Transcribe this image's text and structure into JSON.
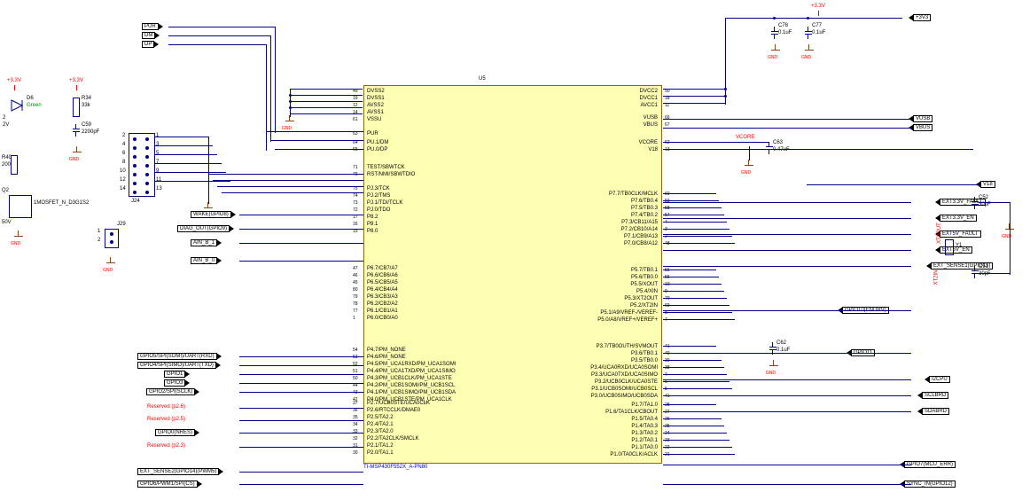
{
  "chip": {
    "ref": "U5",
    "part": "TI-MSP430F552X_A-PN80",
    "pins_left": [
      {
        "num": "49",
        "name": "DVSS2"
      },
      {
        "num": "19",
        "name": "DVSS1"
      },
      {
        "num": "12",
        "name": "AVSS2"
      },
      {
        "num": "14",
        "name": "AVSS1"
      },
      {
        "num": "61",
        "name": "VSSU"
      },
      {
        "num": "63",
        "name": "PUR"
      },
      {
        "num": "64",
        "name": "PU.1/DM"
      },
      {
        "num": "65",
        "name": "PU.0/DP"
      },
      {
        "num": "71",
        "name": "TEST/SBWTCK"
      },
      {
        "num": "76",
        "name": "RST/NMI/SBWTDIO"
      },
      {
        "num": "75",
        "name": "PJ.3/TCK"
      },
      {
        "num": "74",
        "name": "PJ.2/TMS"
      },
      {
        "num": "73",
        "name": "PJ.1/TDI/TCLK"
      },
      {
        "num": "72",
        "name": "PJ.0/TDO"
      },
      {
        "num": "17",
        "name": "P8.2"
      },
      {
        "num": "16",
        "name": "P8.1"
      },
      {
        "num": "15",
        "name": "P8.0"
      },
      {
        "num": "47",
        "name": "P6.7/CB7/A7"
      },
      {
        "num": "46",
        "name": "P6.6/CB6/A6"
      },
      {
        "num": "45",
        "name": "P6.5/CB5/A5"
      },
      {
        "num": "80",
        "name": "P6.4/CB4/A4"
      },
      {
        "num": "79",
        "name": "P6.3/CB3/A3"
      },
      {
        "num": "78",
        "name": "P6.2/CB2/A2"
      },
      {
        "num": "77",
        "name": "P6.1/CB1/A1"
      },
      {
        "num": "1",
        "name": "P6.0/CB0/A0"
      },
      {
        "num": "54",
        "name": "P4.7/PM_NONE"
      },
      {
        "num": "53",
        "name": "P4.6/PM_NONE"
      },
      {
        "num": "52",
        "name": "P4.5/PM_UCA1RXD/PM_UCA1SOMI"
      },
      {
        "num": "51",
        "name": "P4.4/PM_UCA1TXD/PM_UCA1SIMO"
      },
      {
        "num": "50",
        "name": "P4.3/PM_UCB1CLK/PM_UCA1STE"
      },
      {
        "num": "44",
        "name": "P4.2/PM_UCB1SOMI/PM_UCB1SCL"
      },
      {
        "num": "43",
        "name": "P4.1/PM_UCB1SIMO/PM_UCB1SDA"
      },
      {
        "num": "42",
        "name": "P4.0/PM_UCB1STE/PM_UCA1CLK"
      },
      {
        "num": "37",
        "name": "P2.7/UCB0STE/UCA0CLK"
      },
      {
        "num": "36",
        "name": "P2.6/RTCCLK/DMAE0"
      },
      {
        "num": "35",
        "name": "P2.5/TA2.2"
      },
      {
        "num": "34",
        "name": "P2.4/TA2.1"
      },
      {
        "num": "33",
        "name": "P2.3/TA2.0"
      },
      {
        "num": "32",
        "name": "P2.2/TA2CLK/SMCLK"
      },
      {
        "num": "31",
        "name": "P2.1/TA1.2"
      },
      {
        "num": "30",
        "name": "P2.0/TA1.1"
      }
    ],
    "pins_right": [
      {
        "num": "50",
        "name": "DVCC2"
      },
      {
        "num": "18",
        "name": "DVCC1"
      },
      {
        "num": "11",
        "name": "AVCC1"
      },
      {
        "num": "66",
        "name": "VUSB"
      },
      {
        "num": "67",
        "name": "VBUS"
      },
      {
        "num": "62",
        "name": "VCORE"
      },
      {
        "num": "13",
        "name": "V18"
      },
      {
        "num": "60",
        "name": "P7.7/TB0CLK/MCLK"
      },
      {
        "num": "59",
        "name": "P7.6/TB0.4"
      },
      {
        "num": "58",
        "name": "P7.5/TB0.3"
      },
      {
        "num": "57",
        "name": "P7.4/TB0.2"
      },
      {
        "num": "4",
        "name": "P7.3/CB11/A15"
      },
      {
        "num": "3",
        "name": "P7.2/CB10/A14"
      },
      {
        "num": "2",
        "name": "P7.1/CB9/A13"
      },
      {
        "num": "48",
        "name": "P7.0/CB8/A12"
      },
      {
        "num": "56",
        "name": "P5.7/TB0.1"
      },
      {
        "num": "55",
        "name": "P5.6/TB0.0"
      },
      {
        "num": "10",
        "name": "P5.5/XOUT"
      },
      {
        "num": "9",
        "name": "P5.4/XIN"
      },
      {
        "num": "70",
        "name": "P5.3/XT2OUT"
      },
      {
        "num": "69",
        "name": "P5.2/XT2IN"
      },
      {
        "num": "8",
        "name": "P5.1/A9/VREF-/VEREF-"
      },
      {
        "num": "7",
        "name": "P5.0/A8/VREF+/VEREF+"
      },
      {
        "num": "41",
        "name": "P3.7/TB0OUTH/SVMOUT"
      },
      {
        "num": "40",
        "name": "P3.6/TB0.1"
      },
      {
        "num": "39",
        "name": "P3.5/TB0.0"
      },
      {
        "num": "38",
        "name": "P3.4/UCA0RXD/UCA0SOMI"
      },
      {
        "num": "7",
        "name": "P3.3/UCA0TXD/UCA0SIMO"
      },
      {
        "num": "6",
        "name": "P3.2/UCB0CLK/UCA0STE"
      },
      {
        "num": "5",
        "name": "P3.1/UCB0SOMI/UCB0SCL"
      },
      {
        "num": "41",
        "name": "P3.0/UCB0SIMO/UCB0SDA"
      },
      {
        "num": "28",
        "name": "P1.7/TA1.0"
      },
      {
        "num": "27",
        "name": "P1.6/TA1CLK/CBOUT"
      },
      {
        "num": "26",
        "name": "P1.5/TA0.4"
      },
      {
        "num": "25",
        "name": "P1.4/TA0.3"
      },
      {
        "num": "24",
        "name": "P1.3/TA0.2"
      },
      {
        "num": "23",
        "name": "P1.2/TA0.1"
      },
      {
        "num": "22",
        "name": "P1.1/TA0.0"
      },
      {
        "num": "21",
        "name": "P1.0/TA0CLK/ACLK"
      }
    ]
  },
  "nets_top": [
    "PUR",
    "DM",
    "DP"
  ],
  "nets_left_upper": [
    "WAKE(GPIO8)",
    "DIAG_OUT(GPIO9)",
    "AIN_B_1",
    "AIN_B_0"
  ],
  "nets_left_mid": [
    "GPIO5/SPI(SOMI)/UART(RXD)",
    "GPIO4/SPI(SIMO)/UART(TXD)",
    "GPIO1",
    "GPIO3",
    "GPIO2/SPI(SCLK)"
  ],
  "nets_left_res": [
    "Reserved (p2.6)",
    "Reserved (p2.5)",
    "GPIO0(NRES)",
    "Reserved (p2.3)"
  ],
  "nets_left_bot": [
    "EXT_SENSE2(GPIO14)(PWM5)",
    "GPIO6/PWM1/SPI(CS)"
  ],
  "nets_right": [
    "+3V3",
    "VUSB",
    "VBUS",
    "VCORE",
    "V18",
    "EXT3.3V_FAULT",
    "EXT3.3V_EN",
    "EXT5V_FAULT",
    "EXT5V_EN",
    "EXT_SENSE1(GPIO13)",
    "GPIO10(ENDRV)",
    "GPIO11",
    "I2CPU",
    "SCLBRD",
    "SDABRD",
    "GPIO7(MCU_ERR)",
    "SYNC_IN(GPIO12)"
  ],
  "nets_xtal": [
    "XT2OUT",
    "XT2IN"
  ],
  "caps": [
    {
      "ref": "C78",
      "val": "0.1uF"
    },
    {
      "ref": "C77",
      "val": "0.1uF"
    },
    {
      "ref": "C63",
      "val": "0.47uF"
    },
    {
      "ref": "C62",
      "val": "0.1uF"
    },
    {
      "ref": "C52",
      "val": "30pF"
    },
    {
      "ref": "C51",
      "val": "30pF"
    },
    {
      "ref": "C59",
      "val": "2200pF"
    }
  ],
  "res": [
    {
      "ref": "R34",
      "val": "33k"
    },
    {
      "ref": "R40",
      "val": "200"
    }
  ],
  "diode": {
    "ref": "D6",
    "val": "Green",
    "pin": "2"
  },
  "mosfet": {
    "ref": "Q2",
    "val": "1MOSFET_N_D3G1S2",
    "volt": "50V"
  },
  "xtal": {
    "ref": "Y1"
  },
  "power": {
    "p33": "+3.3V",
    "p2v": "2V"
  },
  "gnd": "GND",
  "header": {
    "ref": "J24",
    "pins": [
      "1",
      "2",
      "3",
      "4",
      "5",
      "6",
      "7",
      "8",
      "9",
      "10",
      "11",
      "12",
      "13",
      "14"
    ]
  },
  "j29": {
    "ref": "J29",
    "pins": [
      "1",
      "2"
    ]
  }
}
